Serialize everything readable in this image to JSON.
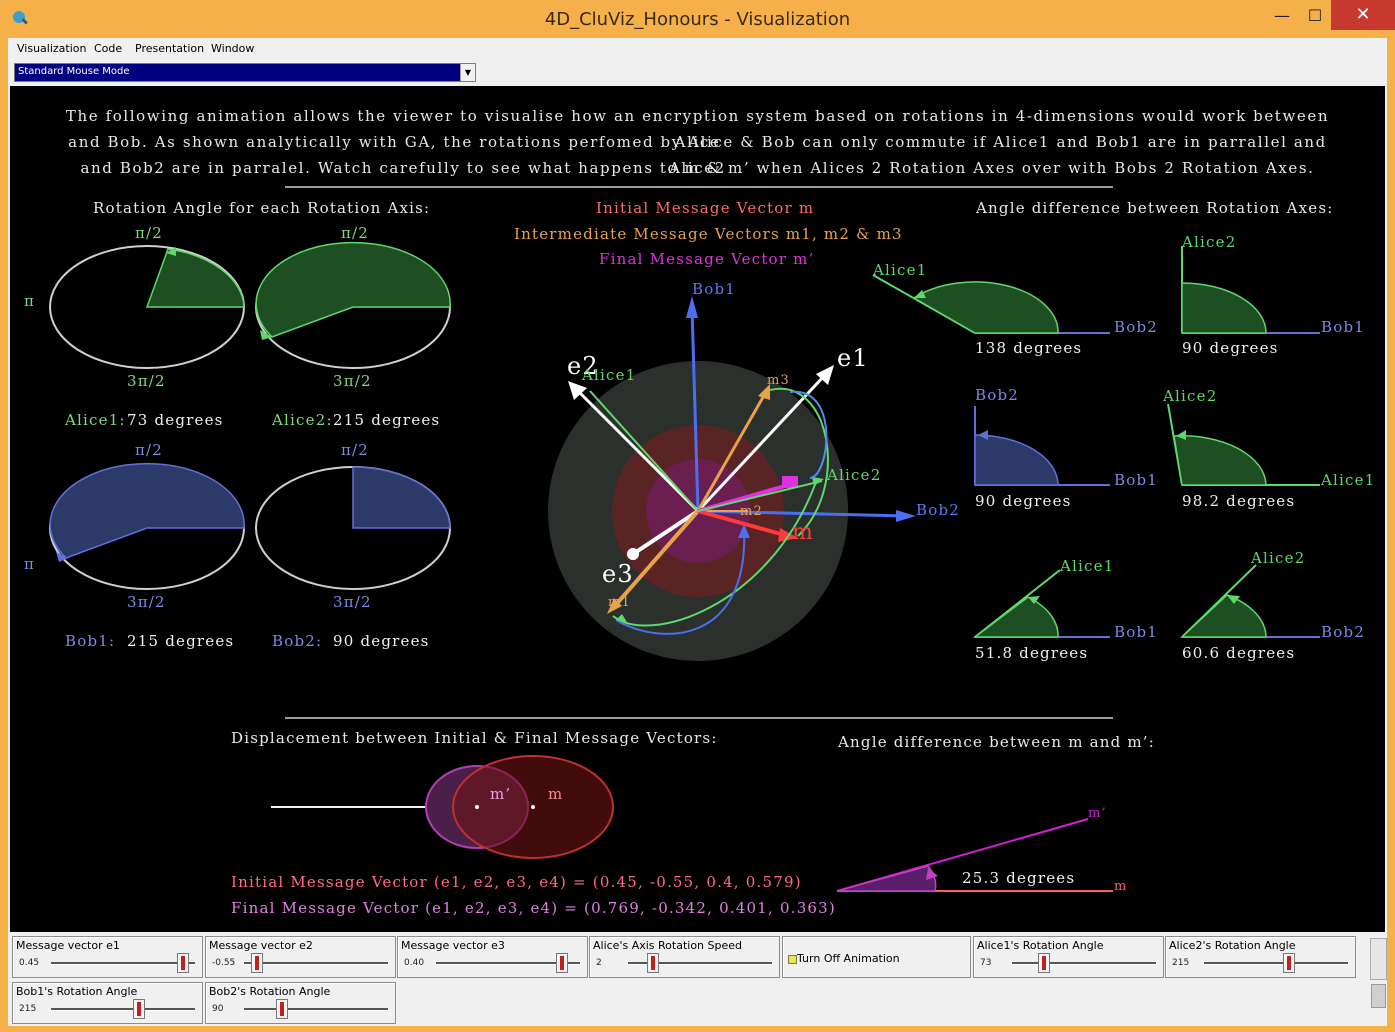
{
  "window": {
    "title": "4D_CluViz_Honours - Visualization",
    "minimize_glyph": "—",
    "maximize_glyph": "☐",
    "close_glyph": "✕",
    "icon": "cluviz-app-icon"
  },
  "menu": {
    "items": [
      {
        "label": "Visualization",
        "key": "V"
      },
      {
        "label": "Code",
        "key": "C"
      },
      {
        "label": "Presentation",
        "key": "P"
      },
      {
        "label": "Window",
        "key": "W"
      }
    ]
  },
  "mouse_mode": {
    "selected": "Standard Mouse Mode"
  },
  "intro": {
    "line1": "The following animation allows the viewer to visualise how an encryption system based on rotations in 4-dimensions would work between Alice",
    "line2": "and Bob. As shown analytically with GA, the rotations perfomed by Alice & Bob can only commute if Alice1 and Bob1 are in parrallel and Alice2",
    "line3": "and Bob2 are in parralel. Watch carefully to see what happens to m & m’ when Alices 2 Rotation Axes over with Bobs 2 Rotation Axes."
  },
  "rotation_panel": {
    "heading": "Rotation Angle for each Rotation Axis:",
    "pi_half": "π/2",
    "three_pi_half": "3π/2",
    "pi": "π",
    "dials": [
      {
        "name": "Alice1:",
        "value": "73 degrees",
        "angle": 73,
        "pi_label": "π"
      },
      {
        "name": "Alice2:",
        "value": "215 degrees",
        "angle": 215,
        "pi_label": ""
      },
      {
        "name": "Bob1:",
        "value": "215 degrees",
        "angle": 215,
        "pi_label": "π"
      },
      {
        "name": "Bob2:",
        "value": "90 degrees",
        "angle": 90,
        "pi_label": ""
      }
    ]
  },
  "center_panel": {
    "legend_initial": "Initial Message Vector m",
    "legend_intermediate": "Intermediate Message Vectors m1, m2 & m3",
    "legend_final": "Final Message Vector m’",
    "axes": {
      "e1": "e1",
      "e2": "e2",
      "e3": "e3",
      "bob1": "Bob1",
      "bob2": "Bob2",
      "alice1": "Alice1",
      "alice2": "Alice2",
      "m": "m",
      "m1": "m1",
      "m2": "m2",
      "m3": "m3"
    }
  },
  "angle_panel": {
    "heading": "Angle difference between Rotation Axes:",
    "pairs": [
      {
        "a": "Alice1",
        "b": "Bob2",
        "value": "138 degrees",
        "angle": 138
      },
      {
        "a": "Alice2",
        "b": "Bob1",
        "value": "90 degrees",
        "angle": 90
      },
      {
        "a": "Bob2",
        "b": "Bob1",
        "value": "90 degrees",
        "angle": 90
      },
      {
        "a": "Alice2",
        "b": "Alice1",
        "value": "98.2 degrees",
        "angle": 98.2
      },
      {
        "a": "Alice1",
        "b": "Bob1",
        "value": "51.8 degrees",
        "angle": 51.8
      },
      {
        "a": "Alice2",
        "b": "Bob2",
        "value": "60.6 degrees",
        "angle": 60.6
      }
    ]
  },
  "displacement": {
    "heading": "Displacement between Initial & Final Message Vectors:",
    "m_prime": "m’",
    "m": "m",
    "initial_line": "Initial Message Vector (e1, e2, e3, e4) = (0.45, -0.55, 0.4, 0.579)",
    "final_line": "Final Message Vector (e1, e2, e3, e4) = (0.769, -0.342, 0.401, 0.363)"
  },
  "m_angle": {
    "heading": "Angle difference between m and m’:",
    "value": "25.3 degrees",
    "angle": 25.3,
    "m_prime": "m’",
    "m": "m"
  },
  "controls": {
    "row1": [
      {
        "label": "Message vector e1",
        "value": "0.45",
        "fraction": 0.9
      },
      {
        "label": "Message vector e2",
        "value": "-0.55",
        "fraction": 0.07
      },
      {
        "label": "Message vector e3",
        "value": "0.40",
        "fraction": 0.88
      },
      {
        "label": "Alice's Axis Rotation Speed",
        "value": "2",
        "fraction": 0.07
      },
      {
        "label": "Turn Off Animation",
        "checkbox": true
      },
      {
        "label": "Alice1's Rotation Angle",
        "value": "73",
        "fraction": 0.2
      },
      {
        "label": "Alice2's Rotation Angle",
        "value": "215",
        "fraction": 0.6
      }
    ],
    "row2": [
      {
        "label": "Bob1's Rotation Angle",
        "value": "215",
        "fraction": 0.6
      },
      {
        "label": "Bob2's Rotation Angle",
        "value": "90",
        "fraction": 0.25
      }
    ]
  },
  "colors": {
    "green_fill": "#1e4f22",
    "green_line": "#5fd86a",
    "blue_fill": "#2c3a6a",
    "blue_line": "#6070d8",
    "alice_text": "#7ddc7d",
    "bob_text": "#7e8ae6",
    "red_vector": "#ff3a3a",
    "orange": "#e6a34a",
    "magenta": "#e030e0",
    "pink_text": "#ff6a8a"
  }
}
